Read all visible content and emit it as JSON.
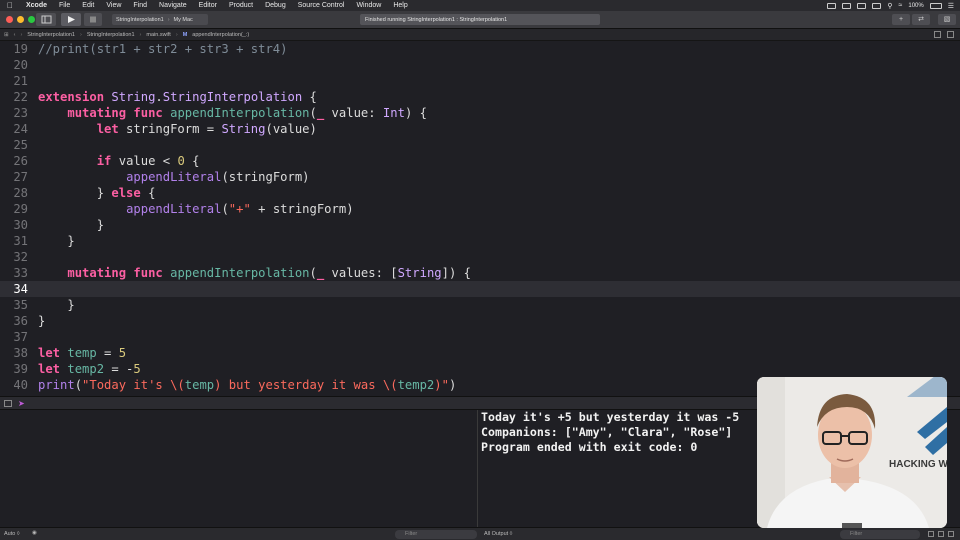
{
  "menubar": {
    "apple_icon": "apple-logo-icon",
    "app_name": "Xcode",
    "items": [
      "File",
      "Edit",
      "View",
      "Find",
      "Navigate",
      "Editor",
      "Product",
      "Debug",
      "Source Control",
      "Window",
      "Help"
    ],
    "battery": "100%"
  },
  "toolbar": {
    "scheme": "StringInterpolation1",
    "destination": "My Mac",
    "status": "Finished running StringInterpolation1 : StringInterpolation1"
  },
  "jumpbar": {
    "crumbs": [
      "StringInterpolation1",
      "StringInterpolation1",
      "main.swift",
      "appendInterpolation(_:)"
    ]
  },
  "editor": {
    "current_line": 34,
    "lines": [
      {
        "n": "19",
        "tokens": [
          {
            "t": "//print(str1 + str2 + str3 + str4)",
            "c": "cmt"
          }
        ]
      },
      {
        "n": "20",
        "tokens": []
      },
      {
        "n": "21",
        "tokens": []
      },
      {
        "n": "22",
        "tokens": [
          {
            "t": "extension",
            "c": "kw"
          },
          {
            "t": " "
          },
          {
            "t": "String",
            "c": "ty"
          },
          {
            "t": "."
          },
          {
            "t": "StringInterpolation",
            "c": "ty"
          },
          {
            "t": " {"
          }
        ]
      },
      {
        "n": "23",
        "tokens": [
          {
            "t": "    "
          },
          {
            "t": "mutating",
            "c": "kw"
          },
          {
            "t": " "
          },
          {
            "t": "func",
            "c": "kw"
          },
          {
            "t": " "
          },
          {
            "t": "appendInterpolation",
            "c": "id"
          },
          {
            "t": "("
          },
          {
            "t": "_",
            "c": "kw"
          },
          {
            "t": " value: "
          },
          {
            "t": "Int",
            "c": "ty"
          },
          {
            "t": ") {"
          }
        ]
      },
      {
        "n": "24",
        "tokens": [
          {
            "t": "        "
          },
          {
            "t": "let",
            "c": "kw"
          },
          {
            "t": " stringForm = "
          },
          {
            "t": "String",
            "c": "ty"
          },
          {
            "t": "(value)"
          }
        ]
      },
      {
        "n": "25",
        "tokens": []
      },
      {
        "n": "26",
        "tokens": [
          {
            "t": "        "
          },
          {
            "t": "if",
            "c": "kw"
          },
          {
            "t": " value < "
          },
          {
            "t": "0",
            "c": "num"
          },
          {
            "t": " {"
          }
        ]
      },
      {
        "n": "27",
        "tokens": [
          {
            "t": "            "
          },
          {
            "t": "appendLiteral",
            "c": "fn"
          },
          {
            "t": "(stringForm)"
          }
        ]
      },
      {
        "n": "28",
        "tokens": [
          {
            "t": "        } "
          },
          {
            "t": "else",
            "c": "kw"
          },
          {
            "t": " {"
          }
        ]
      },
      {
        "n": "29",
        "tokens": [
          {
            "t": "            "
          },
          {
            "t": "appendLiteral",
            "c": "fn"
          },
          {
            "t": "("
          },
          {
            "t": "\"+\"",
            "c": "str"
          },
          {
            "t": " + stringForm)"
          }
        ]
      },
      {
        "n": "30",
        "tokens": [
          {
            "t": "        }"
          }
        ]
      },
      {
        "n": "31",
        "tokens": [
          {
            "t": "    }"
          }
        ]
      },
      {
        "n": "32",
        "tokens": []
      },
      {
        "n": "33",
        "tokens": [
          {
            "t": "    "
          },
          {
            "t": "mutating",
            "c": "kw"
          },
          {
            "t": " "
          },
          {
            "t": "func",
            "c": "kw"
          },
          {
            "t": " "
          },
          {
            "t": "appendInterpolation",
            "c": "id"
          },
          {
            "t": "("
          },
          {
            "t": "_",
            "c": "kw"
          },
          {
            "t": " values: ["
          },
          {
            "t": "String",
            "c": "ty"
          },
          {
            "t": "]) {"
          }
        ]
      },
      {
        "n": "34",
        "tokens": []
      },
      {
        "n": "35",
        "tokens": [
          {
            "t": "    }"
          }
        ]
      },
      {
        "n": "36",
        "tokens": [
          {
            "t": "}"
          }
        ]
      },
      {
        "n": "37",
        "tokens": []
      },
      {
        "n": "38",
        "tokens": [
          {
            "t": "let",
            "c": "kw"
          },
          {
            "t": " "
          },
          {
            "t": "temp",
            "c": "id"
          },
          {
            "t": " = "
          },
          {
            "t": "5",
            "c": "num"
          }
        ]
      },
      {
        "n": "39",
        "tokens": [
          {
            "t": "let",
            "c": "kw"
          },
          {
            "t": " "
          },
          {
            "t": "temp2",
            "c": "id"
          },
          {
            "t": " = -"
          },
          {
            "t": "5",
            "c": "num"
          }
        ]
      },
      {
        "n": "40",
        "tokens": [
          {
            "t": "print",
            "c": "fn"
          },
          {
            "t": "("
          },
          {
            "t": "\"Today it's \\(",
            "c": "str"
          },
          {
            "t": "temp",
            "c": "id"
          },
          {
            "t": ") but yesterday it was \\(",
            "c": "str"
          },
          {
            "t": "temp2",
            "c": "id"
          },
          {
            "t": ")\"",
            "c": "str"
          },
          {
            "t": ")"
          }
        ]
      }
    ]
  },
  "console": {
    "lines": [
      "Today it's +5 but yesterday it was -5",
      "Companions: [\"Amy\", \"Clara\", \"Rose\"]",
      "Program ended with exit code: 0"
    ]
  },
  "bottombar": {
    "variables_scope": "Auto ◊",
    "filter_placeholder": "Filter",
    "output_scope": "All Output ◊",
    "console_filter_placeholder": "Filter"
  },
  "webcam": {
    "background_text": "HACKING W"
  },
  "colors": {
    "keyword": "#fc5fa3",
    "type": "#d0a8ff",
    "function": "#b281eb",
    "identifier": "#67b7a4",
    "number": "#d9c97c",
    "string": "#fc6a5d",
    "comment": "#7f8c98"
  }
}
